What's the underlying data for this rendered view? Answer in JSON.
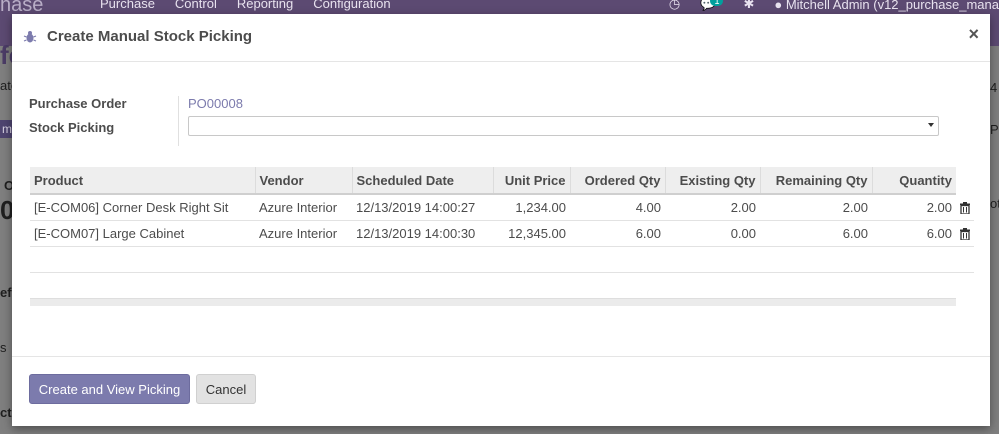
{
  "background": {
    "brand": "hase",
    "menu": [
      "Purchase",
      "Control",
      "Reporting",
      "Configuration"
    ],
    "user": "Mitchell Admin (v12_purchase_mana",
    "chat_count": "1",
    "fragments": {
      "f1": "fo",
      "f2": "ate",
      "f3": "mi",
      "f4": "O",
      "f5": "00",
      "f6": "efe",
      "f7": "s",
      "f8": "ct",
      "f9": "4",
      "f10": "Pu",
      "f11": "ot"
    }
  },
  "dialog": {
    "title": "Create Manual Stock Picking",
    "close_glyph": "×",
    "fields": {
      "purchase_order_label": "Purchase Order",
      "purchase_order_value": "PO00008",
      "stock_picking_label": "Stock Picking",
      "stock_picking_value": ""
    },
    "table": {
      "columns": [
        "Product",
        "Vendor",
        "Scheduled Date",
        "Unit Price",
        "Ordered Qty",
        "Existing Qty",
        "Remaining Qty",
        "Quantity"
      ],
      "rows": [
        [
          "[E-COM06] Corner Desk Right Sit",
          "Azure Interior",
          "12/13/2019 14:00:27",
          "1,234.00",
          "4.00",
          "2.00",
          "2.00",
          "2.00"
        ],
        [
          "[E-COM07] Large Cabinet",
          "Azure Interior",
          "12/13/2019 14:00:30",
          "12,345.00",
          "6.00",
          "0.00",
          "6.00",
          "6.00"
        ]
      ]
    },
    "buttons": {
      "create_label": "Create and View Picking",
      "cancel_label": "Cancel"
    }
  },
  "colors": {
    "navbar": "#5c4a72",
    "primary": "#7c7bad",
    "link": "#7c7bad"
  }
}
